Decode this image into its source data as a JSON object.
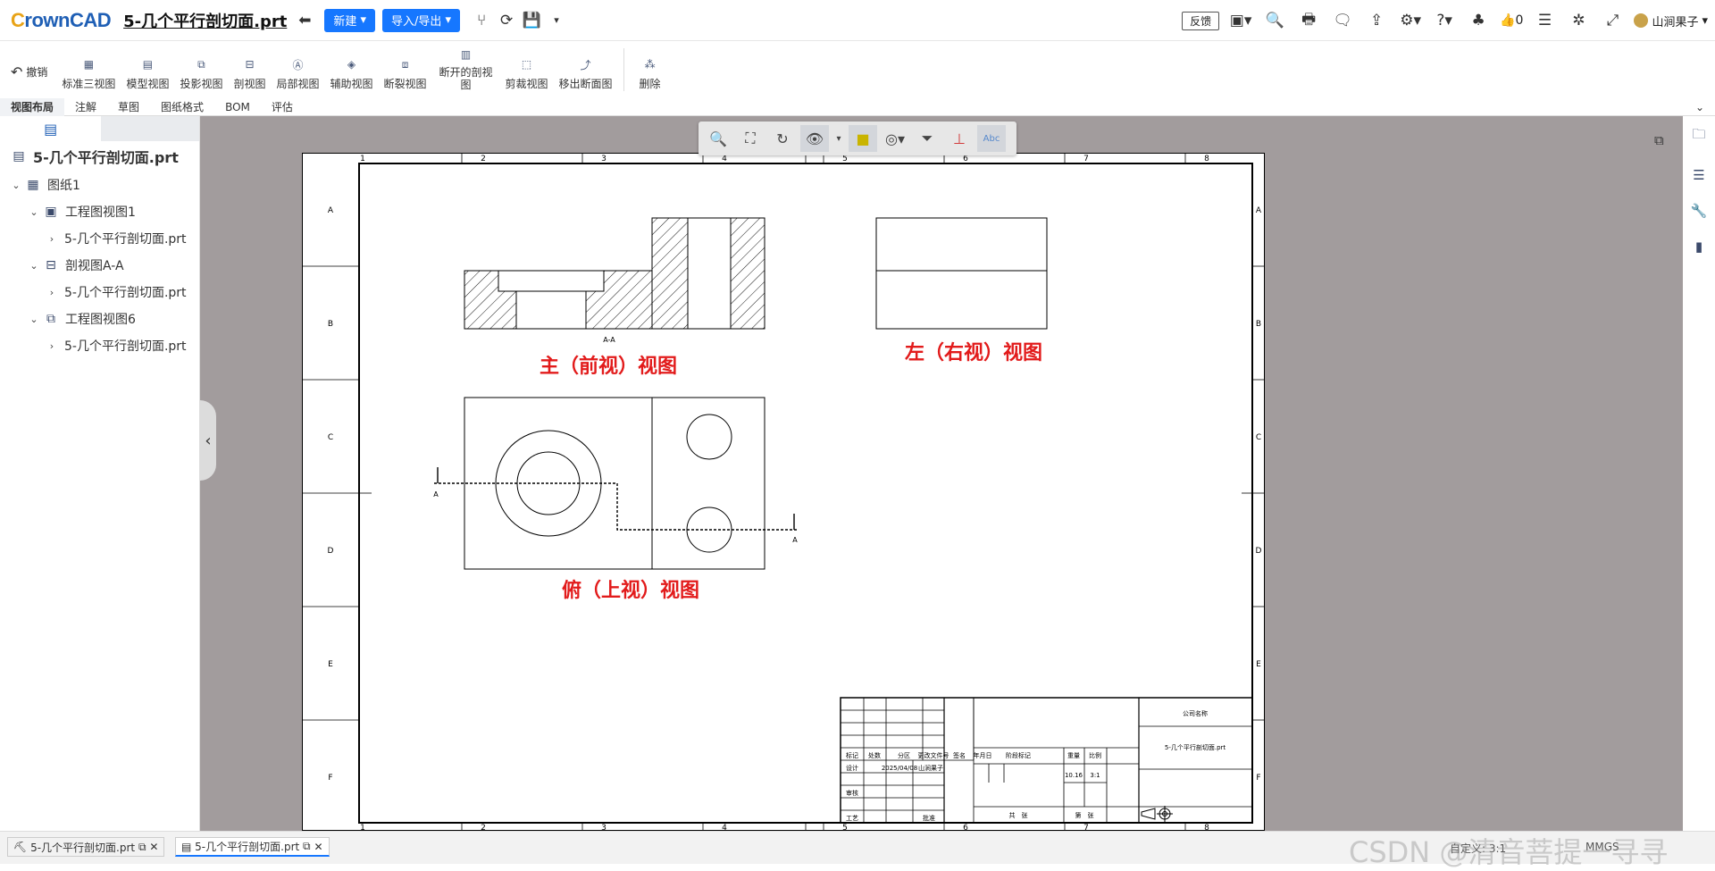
{
  "app": {
    "logo_main": "rownCAD",
    "logo_c": "C",
    "title": "5-几个平行剖切面.prt"
  },
  "topbar": {
    "new_label": "新建",
    "import_label": "导入/导出",
    "feedback": "反馈",
    "likes": "0",
    "user": "山涧果子"
  },
  "ribbon": {
    "undo": "撤销",
    "items": [
      "标准三视图",
      "模型视图",
      "投影视图",
      "剖视图",
      "局部视图",
      "辅助视图",
      "断裂视图",
      "断开的剖视\n图",
      "剪裁视图",
      "移出断面图"
    ],
    "delete": "删除"
  },
  "tabs": [
    "视图布局",
    "注解",
    "草图",
    "图纸格式",
    "BOM",
    "评估"
  ],
  "tree": {
    "root": "5-几个平行剖切面.prt",
    "sheet": "图纸1",
    "view1": "工程图视图1",
    "view1_child": "5-几个平行剖切面.prt",
    "view2": "剖视图A-A",
    "view2_child": "5-几个平行剖切面.prt",
    "view3": "工程图视图6",
    "view3_child": "5-几个平行剖切面.prt"
  },
  "drawing": {
    "col_labels": [
      "1",
      "2",
      "3",
      "4",
      "5",
      "6",
      "7",
      "8"
    ],
    "row_labels": [
      "A",
      "B",
      "C",
      "D",
      "E",
      "F"
    ],
    "section_label": "A-A",
    "cut_label": "A",
    "annotation_front": "主（前视）视图",
    "annotation_left": "左（右视）视图",
    "annotation_top": "俯（上视）视图",
    "tb_company": "公司名称",
    "tb_filename": "5-几个平行剖切面.prt",
    "tb_date": "2025/04/08",
    "tb_designer": "山涧果子",
    "tb_weight": "10.16",
    "tb_scale": "3:1",
    "tb_h1": "标记",
    "tb_h2": "处数",
    "tb_h3": "分区",
    "tb_h4": "更改文件号",
    "tb_h5": "签名",
    "tb_h6": "年月日",
    "tb_design": "设计",
    "tb_review": "审核",
    "tb_process": "工艺",
    "tb_approve": "批准",
    "tb_stage": "阶段标记",
    "tb_wt": "重量",
    "tb_sc": "比例",
    "tb_total": "共　张",
    "tb_sheet": "第　张"
  },
  "bottom": {
    "tab1": "5-几个平行剖切面.prt",
    "tab2": "5-几个平行剖切面.prt",
    "scale_status": "自定义: 3:1",
    "units": "MMGS",
    "watermark": "CSDN @清音菩提一寻寻"
  }
}
